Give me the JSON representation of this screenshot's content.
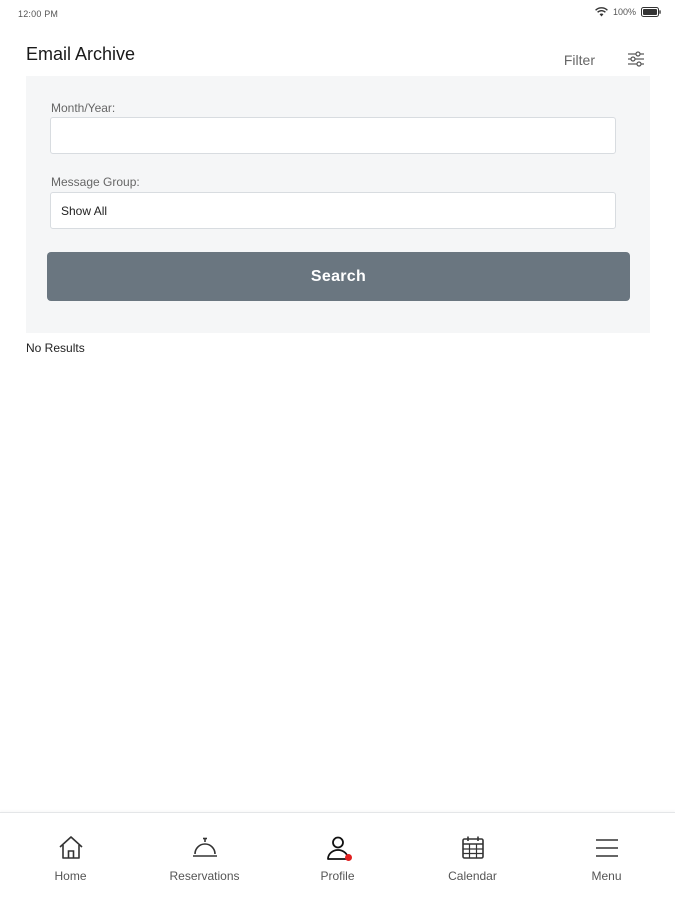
{
  "status_bar": {
    "time": "12:00 PM",
    "battery": "100%",
    "wifi_icon": "wifi-icon",
    "battery_icon": "battery-icon"
  },
  "header": {
    "title": "Email Archive",
    "filter_label": "Filter",
    "filter_icon": "sliders-icon"
  },
  "filters": {
    "month_year": {
      "label": "Month/Year:",
      "value": ""
    },
    "message_group": {
      "label": "Message Group:",
      "selected": "Show All"
    },
    "search_label": "Search"
  },
  "results": {
    "empty_text": "No Results"
  },
  "bottom_nav": {
    "items": [
      {
        "label": "Home",
        "icon": "home-icon"
      },
      {
        "label": "Reservations",
        "icon": "service-bell-icon"
      },
      {
        "label": "Profile",
        "icon": "person-icon"
      },
      {
        "label": "Calendar",
        "icon": "calendar-icon"
      },
      {
        "label": "Menu",
        "icon": "hamburger-menu-icon"
      }
    ]
  },
  "colors": {
    "panel_background": "#f5f6f7",
    "search_button": "#6a7680",
    "notification_dot": "#e02020"
  }
}
